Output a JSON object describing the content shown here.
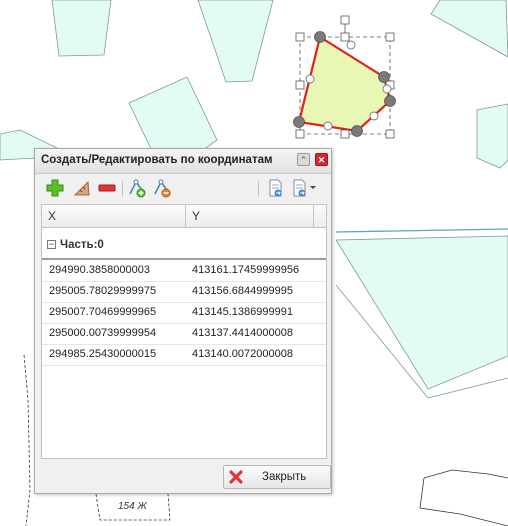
{
  "panel": {
    "title": "Создать/Редактировать по координатам",
    "collapse_glyph": "⌃",
    "close_glyph": "✕"
  },
  "toolbar": {
    "icons": [
      "add-icon",
      "edit-ruler-icon",
      "remove-icon",
      "add-vertex-icon",
      "delete-vertex-icon",
      "import-file-icon",
      "export-file-icon"
    ]
  },
  "grid": {
    "columns": [
      "X",
      "Y"
    ],
    "group_label": "Часть:0",
    "group_toggle": "−",
    "rows": [
      {
        "x": "294990.3858000003",
        "y": "413161.17459999956"
      },
      {
        "x": "295005.78029999975",
        "y": "413156.6844999995"
      },
      {
        "x": "295007.70469999965",
        "y": "413145.1386999991"
      },
      {
        "x": "295000.00739999954",
        "y": "413137.4414000008"
      },
      {
        "x": "294985.25430000015",
        "y": "413140.0072000008"
      }
    ]
  },
  "footer": {
    "close_label": "Закрыть"
  },
  "map": {
    "label": "154 Ж",
    "colors": {
      "parcel_fill": "#e2fbf5",
      "parcel_stroke": "#7e9a94",
      "edit_fill": "#e8f7b4",
      "edit_stroke": "#e0201c",
      "accent_red": "#d9262c"
    }
  }
}
